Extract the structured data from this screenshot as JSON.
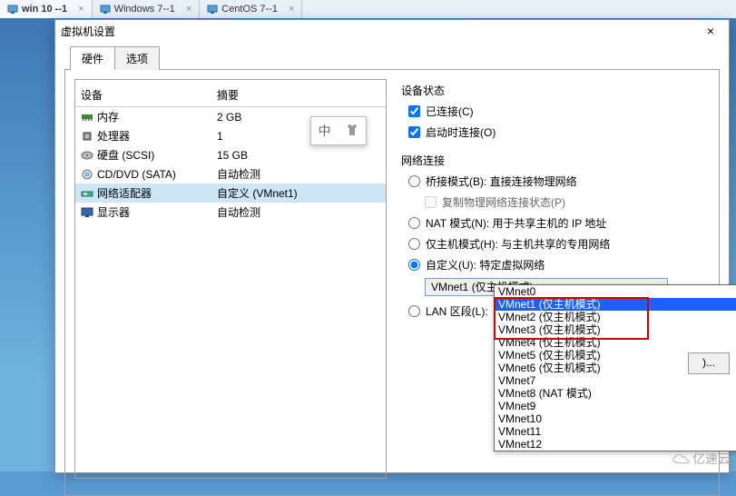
{
  "vm_tabs": [
    {
      "label": "win 10 --1",
      "active": true
    },
    {
      "label": "Windows 7--1",
      "active": false
    },
    {
      "label": "CentOS 7--1",
      "active": false
    }
  ],
  "dialog": {
    "title": "虚拟机设置",
    "tabs": {
      "hardware": "硬件",
      "options": "选项"
    },
    "close": "×"
  },
  "dev_header": {
    "device": "设备",
    "summary": "摘要"
  },
  "devices": [
    {
      "name": "内存",
      "summary": "2 GB",
      "selected": false,
      "icon": "memory-icon"
    },
    {
      "name": "处理器",
      "summary": "1",
      "selected": false,
      "icon": "cpu-icon"
    },
    {
      "name": "硬盘 (SCSI)",
      "summary": "15 GB",
      "selected": false,
      "icon": "disk-icon"
    },
    {
      "name": "CD/DVD (SATA)",
      "summary": "自动检测",
      "selected": false,
      "icon": "cd-icon"
    },
    {
      "name": "网络适配器",
      "summary": "自定义 (VMnet1)",
      "selected": true,
      "icon": "nic-icon"
    },
    {
      "name": "显示器",
      "summary": "自动检测",
      "selected": false,
      "icon": "display-icon"
    }
  ],
  "device_status": {
    "title": "设备状态",
    "connected": "已连接(C)",
    "connect_on_power": "启动时连接(O)"
  },
  "net": {
    "title": "网络连接",
    "bridged": "桥接模式(B): 直接连接物理网络",
    "replicate": "复制物理网络连接状态(P)",
    "nat": "NAT 模式(N): 用于共享主机的 IP 地址",
    "hostonly": "仅主机模式(H): 与主机共享的专用网络",
    "custom": "自定义(U): 特定虚拟网络",
    "lan_segments": "LAN 区段(L):",
    "selected": "VMnet1 (仅主机模式)",
    "options": [
      "VMnet0",
      "VMnet1 (仅主机模式)",
      "VMnet2 (仅主机模式)",
      "VMnet3 (仅主机模式)",
      "VMnet4 (仅主机模式)",
      "VMnet5 (仅主机模式)",
      "VMnet6 (仅主机模式)",
      "VMnet7",
      "VMnet8 (NAT 模式)",
      "VMnet9",
      "VMnet10",
      "VMnet11",
      "VMnet12"
    ]
  },
  "ime": {
    "char": "中"
  },
  "lan_btn": ")...",
  "watermark": "亿速云"
}
